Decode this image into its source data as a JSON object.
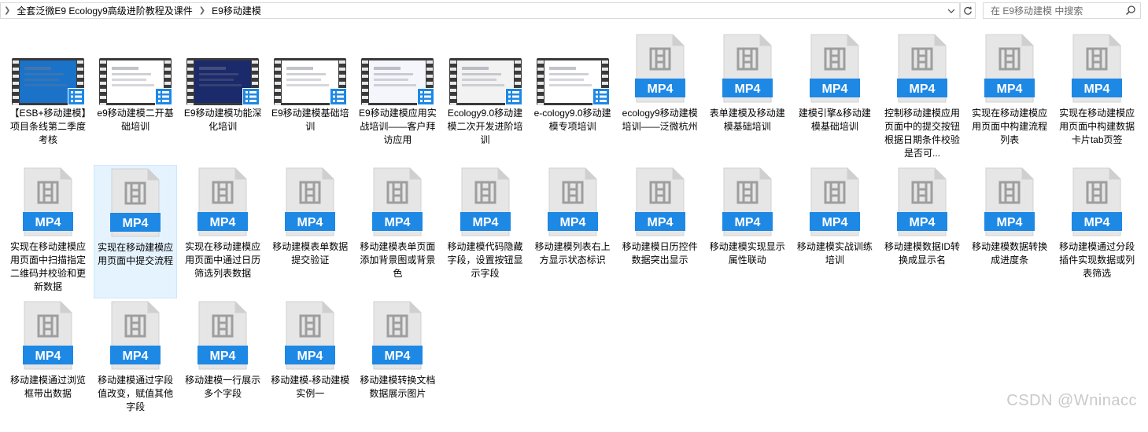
{
  "address": {
    "crumbs": [
      "全套泛微E9 Ecology9高级进阶教程及课件",
      "E9移动建模"
    ]
  },
  "search": {
    "placeholder": "在 E9移动建模 中搜索"
  },
  "colors": {
    "mp4_blue": "#1e88e5",
    "selected_bg": "#e5f3ff"
  },
  "files": [
    {
      "label": "【ESB+移动建模】项目条线第二季度考核",
      "kind": "video",
      "screen": "#1a73c9"
    },
    {
      "label": "e9移动建模二开基础培训",
      "kind": "video",
      "screen": "#ffffff"
    },
    {
      "label": "E9移动建模功能深化培训",
      "kind": "video",
      "screen": "#1b2a6b"
    },
    {
      "label": "E9移动建模基础培训",
      "kind": "video",
      "screen": "#ffffff"
    },
    {
      "label": "E9移动建模应用实战培训——客户拜访应用",
      "kind": "video",
      "screen": "#f4f6fb"
    },
    {
      "label": "Ecology9.0移动建模二次开发进阶培训",
      "kind": "video",
      "screen": "#f2f2f2"
    },
    {
      "label": "e-cology9.0移动建模专项培训",
      "kind": "video",
      "screen": "#ffffff"
    },
    {
      "label": "ecology9移动建模培训——泛微杭州",
      "kind": "mp4"
    },
    {
      "label": "表单建模及移动建模基础培训",
      "kind": "mp4"
    },
    {
      "label": "建模引擎&移动建模基础培训",
      "kind": "mp4"
    },
    {
      "label": "控制移动建模应用页面中的提交按钮根据日期条件校验是否可...",
      "kind": "mp4"
    },
    {
      "label": "实现在移动建模应用页面中构建流程列表",
      "kind": "mp4"
    },
    {
      "label": "实现在移动建模应用页面中构建数据卡片tab页签",
      "kind": "mp4"
    },
    {
      "label": "实现在移动建模应用页面中扫描指定二维码并校验和更新数据",
      "kind": "mp4"
    },
    {
      "label": "实现在移动建模应用页面中提交流程",
      "kind": "mp4",
      "selected": true
    },
    {
      "label": "实现在移动建模应用页面中通过日历筛选列表数据",
      "kind": "mp4"
    },
    {
      "label": "移动建模表单数据提交验证",
      "kind": "mp4"
    },
    {
      "label": "移动建模表单页面添加背景图或背景色",
      "kind": "mp4"
    },
    {
      "label": "移动建模代码隐藏字段，设置按钮显示字段",
      "kind": "mp4"
    },
    {
      "label": "移动建模列表右上方显示状态标识",
      "kind": "mp4"
    },
    {
      "label": "移动建模日历控件数据突出显示",
      "kind": "mp4"
    },
    {
      "label": "移动建模实现显示属性联动",
      "kind": "mp4"
    },
    {
      "label": "移动建模实战训练培训",
      "kind": "mp4"
    },
    {
      "label": "移动建模数据ID转换成显示名",
      "kind": "mp4"
    },
    {
      "label": "移动建模数据转换成进度条",
      "kind": "mp4"
    },
    {
      "label": "移动建模通过分段插件实现数据或列表筛选",
      "kind": "mp4"
    },
    {
      "label": "移动建模通过浏览框带出数据",
      "kind": "mp4"
    },
    {
      "label": "移动建模通过字段值改变，赋值其他字段",
      "kind": "mp4"
    },
    {
      "label": "移动建模一行展示多个字段",
      "kind": "mp4"
    },
    {
      "label": "移动建模-移动建模实例一",
      "kind": "mp4"
    },
    {
      "label": "移动建模转换文档数据展示图片",
      "kind": "mp4"
    }
  ],
  "mp4_text": "MP4",
  "watermark": "CSDN @Wninacc"
}
